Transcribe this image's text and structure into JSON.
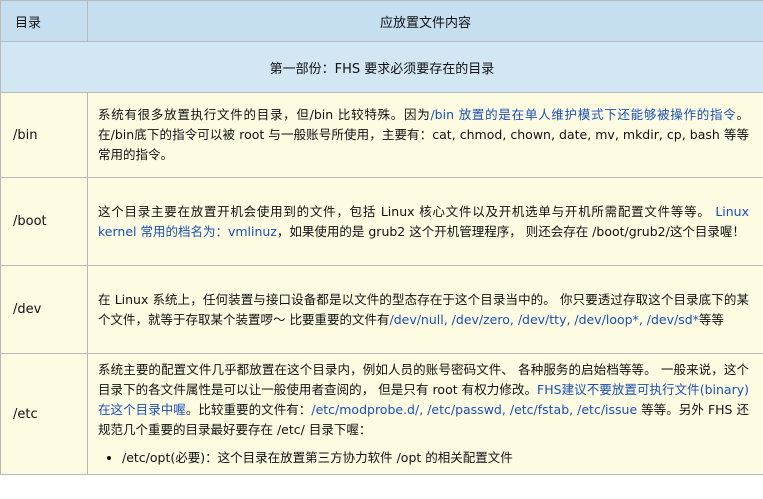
{
  "table": {
    "header": {
      "col_dir": "目录",
      "col_content": "应放置文件内容"
    },
    "section_title": "第一部份：FHS 要求必须要存在的目录",
    "rows": [
      {
        "dir": "/bin",
        "segments": [
          {
            "text": "系统有很多放置执行文件的目录，但/bin 比较特殊。因为",
            "hl": false
          },
          {
            "text": "/bin 放置的是在单人维护模式下还能够被操作的指令",
            "hl": true
          },
          {
            "text": "。在/bin底下的指令可以被 root 与一般账号所使用，主要有：cat, chmod, chown, date, mv, mkdir, cp, bash 等等常用的指令。",
            "hl": false
          }
        ]
      },
      {
        "dir": "/boot",
        "segments": [
          {
            "text": "这个目录主要在放置开机会使用到的文件，包括 Linux 核心文件以及开机选单与开机所需配置文件等等。 ",
            "hl": false
          },
          {
            "text": "Linux kernel 常用的档名为：vmlinuz",
            "hl": true
          },
          {
            "text": "，如果使用的是 grub2 这个开机管理程序， 则还会存在 /boot/grub2/这个目录喔！",
            "hl": false
          }
        ]
      },
      {
        "dir": "/dev",
        "segments": [
          {
            "text": "在 Linux 系统上，任何装置与接口设备都是以文件的型态存在于这个目录当中的。 你只要透过存取这个目录底下的某个文件，就等于存取某个装置啰～ 比要重要的文件有",
            "hl": false
          },
          {
            "text": "/dev/null, /dev/zero, /dev/tty, /dev/loop*, /dev/sd*",
            "hl": true
          },
          {
            "text": "等等",
            "hl": false
          }
        ]
      },
      {
        "dir": "/etc",
        "segments": [
          {
            "text": "系统主要的配置文件几乎都放置在这个目录内，例如人员的账号密码文件、 各种服务的启始档等等。 一般来说，这个目录下的各文件属性是可以让一般使用者查阅的， 但是只有 root 有权力修改。",
            "hl": false
          },
          {
            "text": "FHS建议不要放置可执行文件(binary)在这个目录中喔",
            "hl": true
          },
          {
            "text": "。比较重要的文件有：",
            "hl": false
          },
          {
            "text": "/etc/modprobe.d/, /etc/passwd, /etc/fstab, /etc/issue",
            "hl": true
          },
          {
            "text": " 等等。另外 FHS 还规范几个重要的目录最好要存在 /etc/ 目录下喔：",
            "hl": false
          }
        ],
        "bullet": {
          "path": "/etc/opt(必要)",
          "text": "：这个目录在放置第三方协力软件 /opt 的相关配置文件"
        }
      }
    ]
  }
}
